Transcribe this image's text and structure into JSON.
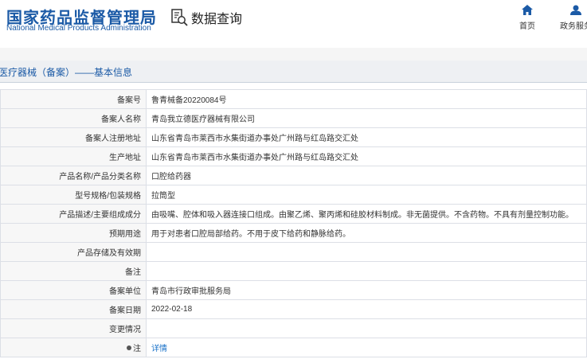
{
  "header": {
    "logo_cn": "国家药品监督管理局",
    "logo_en": "National Medical Products Administration",
    "search_title": "数据查询",
    "nav": {
      "home": "首页",
      "service": "政务服务"
    }
  },
  "page": {
    "title": "医疗器械（备案）——基本信息"
  },
  "rows": [
    {
      "label": "备案号",
      "value": "鲁青械备20220084号"
    },
    {
      "label": "备案人名称",
      "value": "青岛我立德医疗器械有限公司"
    },
    {
      "label": "备案人注册地址",
      "value": "山东省青岛市莱西市水集街道办事处广州路与红岛路交汇处"
    },
    {
      "label": "生产地址",
      "value": "山东省青岛市莱西市水集街道办事处广州路与红岛路交汇处"
    },
    {
      "label": "产品名称/产品分类名称",
      "value": "口腔给药器"
    },
    {
      "label": "型号规格/包装规格",
      "value": "拉筒型"
    },
    {
      "label": "产品描述/主要组成成分",
      "value": "由吸嘴、腔体和吸入器连接口组成。由聚乙烯、聚丙烯和硅胶材料制成。非无菌提供。不含药物。不具有剂量控制功能。"
    },
    {
      "label": "预期用途",
      "value": "用于对患者口腔局部给药。不用于皮下给药和静脉给药。"
    },
    {
      "label": "产品存储及有效期",
      "value": ""
    },
    {
      "label": "备注",
      "value": ""
    },
    {
      "label": "备案单位",
      "value": "青岛市行政审批服务局"
    },
    {
      "label": "备案日期",
      "value": "2022-02-18"
    },
    {
      "label": "变更情况",
      "value": ""
    },
    {
      "label": "注",
      "value": "详情"
    }
  ],
  "icons": {
    "search": "search-document-icon",
    "home": "home-icon",
    "user": "user-icon",
    "note": "pin-icon"
  },
  "colors": {
    "brand": "#1b5aa6",
    "link": "#1b73c9"
  }
}
